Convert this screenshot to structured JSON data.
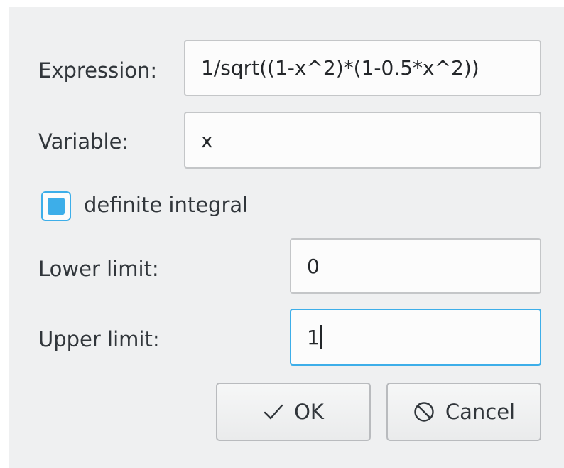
{
  "form": {
    "expression": {
      "label": "Expression:",
      "value": "1/sqrt((1-x^2)*(1-0.5*x^2))"
    },
    "variable": {
      "label": "Variable:",
      "value": "x"
    },
    "definite_integral": {
      "label": "definite integral",
      "checked": true
    },
    "lower_limit": {
      "label": "Lower limit:",
      "value": "0"
    },
    "upper_limit": {
      "label": "Upper limit:",
      "value": "1"
    }
  },
  "buttons": {
    "ok": {
      "label": "OK",
      "icon": "checkmark-icon"
    },
    "cancel": {
      "label": "Cancel",
      "icon": "cancel-circle-icon"
    }
  },
  "colors": {
    "accent": "#3daee9",
    "dialog_background": "#eff0f1",
    "field_background": "#fcfcfc",
    "text": "#31363b"
  }
}
